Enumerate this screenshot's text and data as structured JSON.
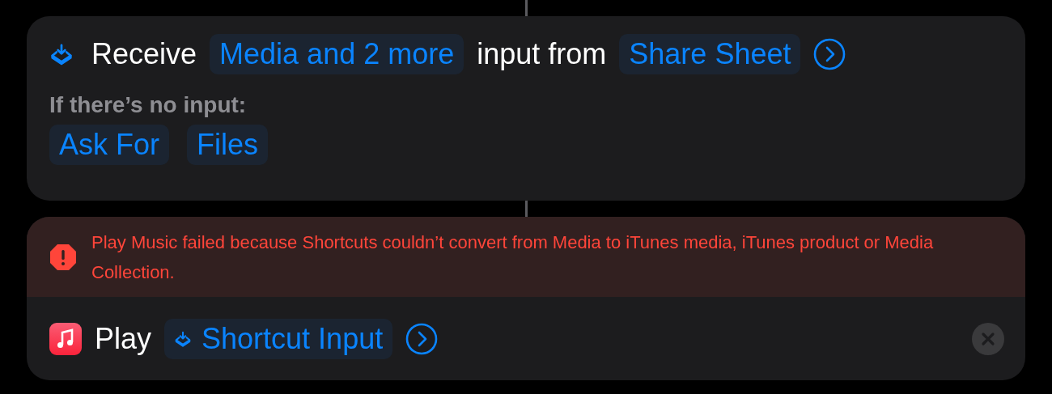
{
  "receive_action": {
    "verb": "Receive",
    "input_types": "Media and 2 more",
    "connector": "input from",
    "source": "Share Sheet",
    "no_input_label": "If there’s no input:",
    "no_input_options": [
      "Ask For",
      "Files"
    ]
  },
  "play_action": {
    "error": "Play Music failed because Shortcuts couldn’t convert from Media to iTunes media, iTunes product or Media Collection.",
    "verb": "Play",
    "parameter": "Shortcut Input"
  }
}
